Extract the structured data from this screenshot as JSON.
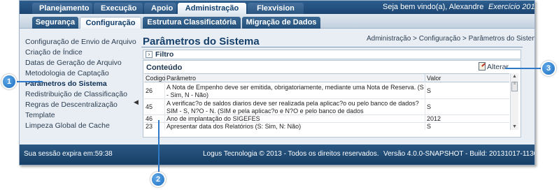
{
  "top_nav": {
    "tabs": [
      {
        "label": "Planejamento"
      },
      {
        "label": "Execução"
      },
      {
        "label": "Apoio"
      },
      {
        "label": "Administração",
        "active": true
      },
      {
        "label": "Flexvision"
      }
    ],
    "welcome": "Seja bem vindo(a), Alexandre",
    "exercise": "Exercício 2013"
  },
  "sub_nav": {
    "tabs": [
      {
        "label": "Segurança"
      },
      {
        "label": "Configuração",
        "active": true
      },
      {
        "label": "Estrutura Classificatória"
      },
      {
        "label": "Migração de Dados"
      }
    ]
  },
  "sidebar": {
    "items": [
      {
        "label": "Configuração de Envio de Arquivo"
      },
      {
        "label": "Criação de Índice"
      },
      {
        "label": "Datas de Geração de Arquivo"
      },
      {
        "label": "Metodologia de Captação"
      },
      {
        "label": "Parâmetros do Sistema",
        "active": true
      },
      {
        "label": "Redistribuição de Classificação"
      },
      {
        "label": "Regras de Descentralização"
      },
      {
        "label": "Template"
      },
      {
        "label": "Limpeza Global de Cache"
      }
    ]
  },
  "main": {
    "title": "Parâmetros do Sistema",
    "breadcrumb": "Administração > Configuração > Parâmetros do Sistema",
    "filter_label": "Filtro",
    "content_label": "Conteúdo",
    "alter_label": "Alterar",
    "table": {
      "headers": [
        "Codigo",
        "Parâmetro",
        "Valor"
      ],
      "rows": [
        {
          "code": "26",
          "param": "A Nota de Empenho deve ser emitida, obrigatoriamente, mediante uma Nota de Reserva. (S - Sim, N - Não)",
          "value": "S"
        },
        {
          "code": "45",
          "param": "A verificac?o de saldos diarios deve ser realizada pela aplicac?o ou pelo banco de dados? SIM - S, N?O - N. (SIM e pela aplicac?o e N?O e pelo banco de dados",
          "value": "S"
        },
        {
          "code": "46",
          "param": "Ano de implantação do SIGEFES",
          "value": "2012"
        },
        {
          "code": "23",
          "param": "Apresentar data dos Relatórios (S: Sim, N: Não)",
          "value": "S"
        }
      ]
    }
  },
  "footer": {
    "session": "Sua sessão expira em:59:38",
    "copyright": "Logus Tecnologia © 2013 - Todos os direitos reservados.",
    "version": "Versão 4.0.0-SNAPSHOT - Build: 20131017-1130"
  },
  "callouts": [
    "1",
    "2",
    "3"
  ],
  "colors": {
    "nav_dark": "#1c4470",
    "accent": "#2f79c9",
    "title": "#143f6b"
  }
}
